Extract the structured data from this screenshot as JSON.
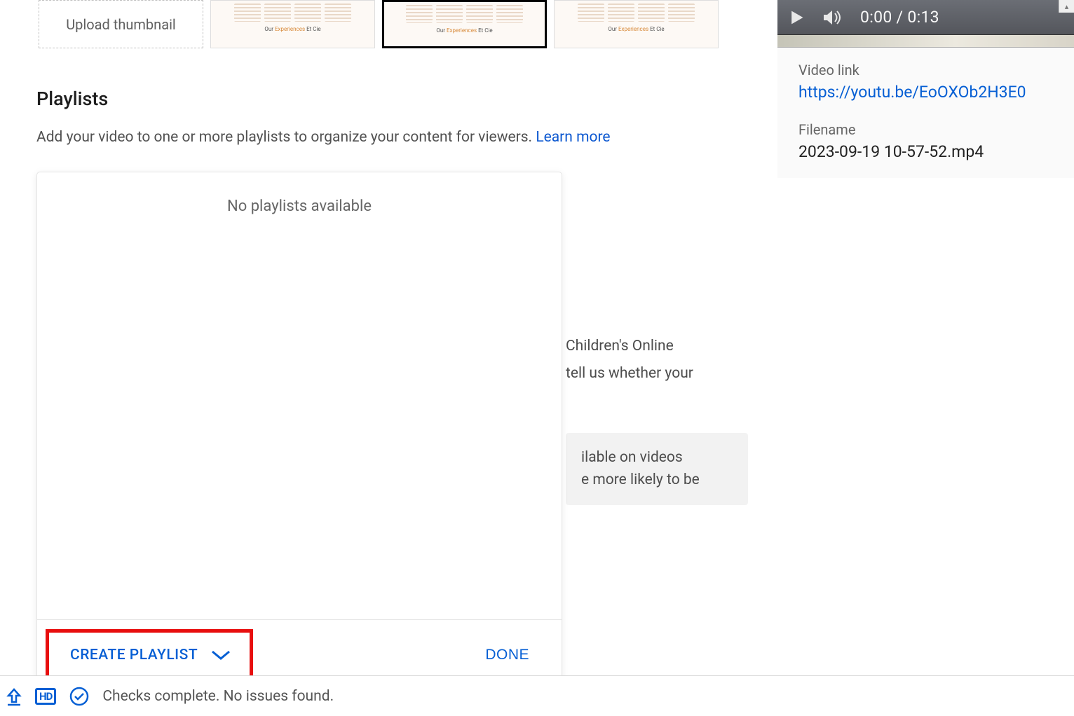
{
  "thumbnails": {
    "upload_label": "Upload thumbnail",
    "caption_prefix": "Our ",
    "caption_orange": "Experiences",
    "caption_suffix": " Et Cie"
  },
  "playlists": {
    "title": "Playlists",
    "description": "Add your video to one or more playlists to organize your content for viewers. ",
    "learn_more": "Learn more",
    "empty": "No playlists available",
    "create_label": "CREATE PLAYLIST",
    "done_label": "DONE"
  },
  "behind": {
    "line1": "Children's Online",
    "line2": "tell us whether your",
    "box_line1": "ilable on videos",
    "box_line2": "e more likely to be"
  },
  "player": {
    "time": "0:00 / 0:13"
  },
  "video": {
    "link_label": "Video link",
    "link_value": "https://youtu.be/EoOXOb2H3E0",
    "filename_label": "Filename",
    "filename_value": "2023-09-19 10-57-52.mp4"
  },
  "status": {
    "hd": "HD",
    "text": "Checks complete. No issues found."
  }
}
